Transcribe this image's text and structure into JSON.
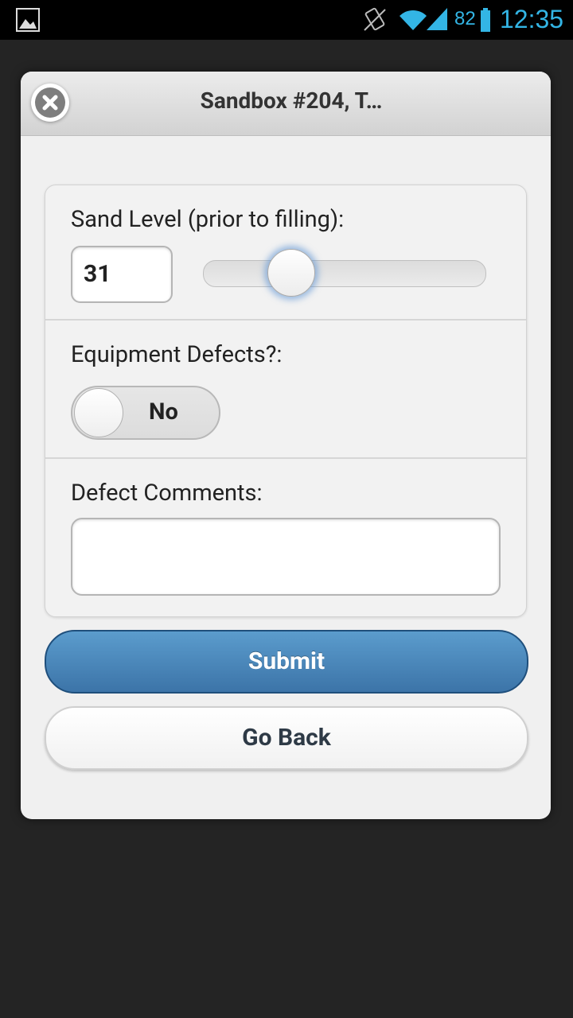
{
  "status_bar": {
    "battery_level": "82",
    "time": "12:35",
    "accent_color": "#33b5e5"
  },
  "dialog": {
    "title": "Sandbox #204, T…",
    "close_icon": "close-circle-icon"
  },
  "form": {
    "sand_level": {
      "label": "Sand Level (prior to filling):",
      "value": "31",
      "slider_fraction": 0.31
    },
    "equipment_defects": {
      "label": "Equipment Defects?:",
      "toggle_value": "No"
    },
    "defect_comments": {
      "label": "Defect Comments:",
      "value": ""
    }
  },
  "buttons": {
    "submit_label": "Submit",
    "back_label": "Go Back"
  }
}
